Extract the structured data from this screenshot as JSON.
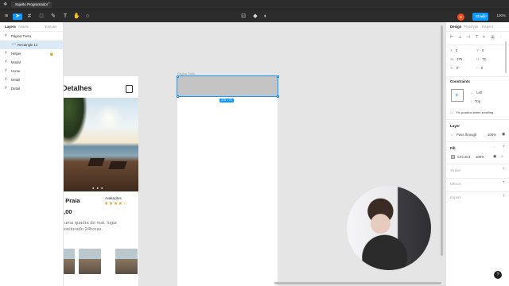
{
  "titlebar": {
    "file_name": "Sujeito Programador"
  },
  "toolbar": {
    "share_label": "Share",
    "zoom": "100%",
    "user_initial": "S"
  },
  "left_panel": {
    "tabs": [
      "Layers",
      "Assets",
      "Youtube"
    ],
    "layers": [
      {
        "name": "Página Tonto",
        "selected": false,
        "child": false
      },
      {
        "name": "Rectangle 14",
        "selected": true,
        "child": true
      },
      {
        "name": "Helper",
        "selected": false,
        "child": false
      },
      {
        "name": "Modal",
        "selected": false,
        "child": false
      },
      {
        "name": "Home",
        "selected": false,
        "child": false
      },
      {
        "name": "Detail",
        "selected": false,
        "child": false
      },
      {
        "name": "Detail",
        "selected": false,
        "child": false
      }
    ]
  },
  "canvas": {
    "frame_left": {
      "title": "Detalhes",
      "place": "e Praia",
      "rating_label": "Avaliações",
      "stars": "★★★★☆",
      "price": "4,00",
      "description": "a uma quadra do mar, lugar monitorado 24horas."
    },
    "frame_right_label": "Página Tonto",
    "selection_dimensions": "375 × 72"
  },
  "right_panel": {
    "tabs": [
      "Design",
      "Prototype",
      "Inspect"
    ],
    "position": {
      "x": "0",
      "y": "0",
      "w": "375",
      "h": "72",
      "rotation": "0°",
      "radius": "0"
    },
    "constraints": {
      "title": "Constraints",
      "horizontal": "Left",
      "vertical": "Top",
      "fix_scroll": "Fix position when scrolling"
    },
    "layer": {
      "title": "Layer",
      "blend": "Pass through",
      "opacity": "100%"
    },
    "fill": {
      "title": "Fill",
      "hex": "C4C4C4",
      "opacity": "100%",
      "color": "#C4C4C4"
    },
    "stroke_title": "Stroke",
    "effects_title": "Effects",
    "export_title": "Export"
  },
  "colors": {
    "accent": "#0d99ff",
    "toolbar": "#2c2c2c"
  }
}
